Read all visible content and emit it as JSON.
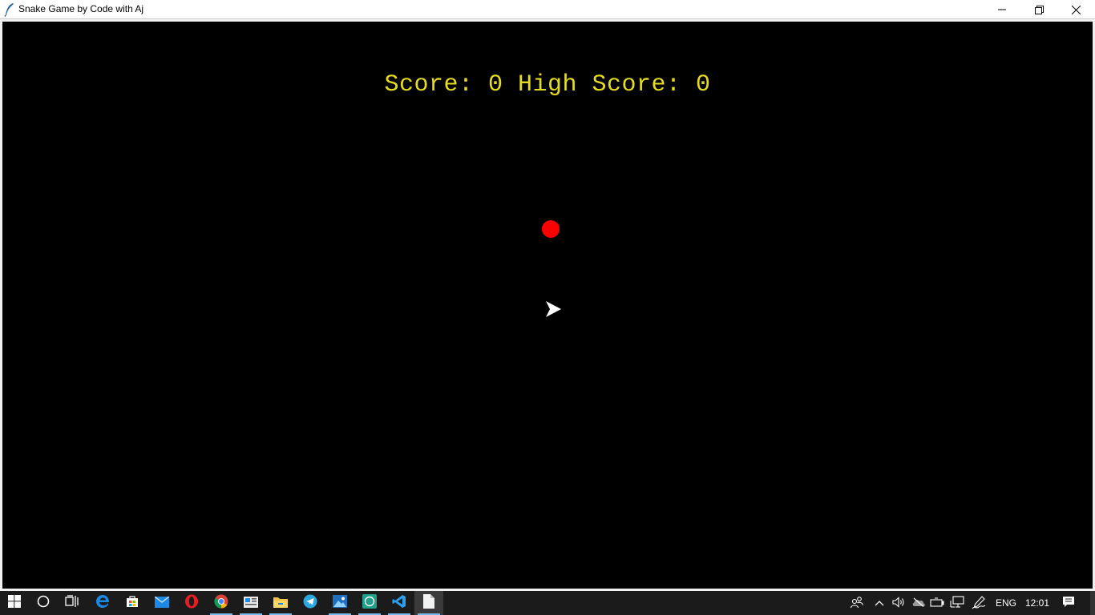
{
  "window": {
    "title": "Snake Game by Code with Aj",
    "icon": "feather-icon",
    "controls": [
      "minimize-icon",
      "restore-icon",
      "close-icon"
    ]
  },
  "game": {
    "score_text": "Score: 0 High Score: 0",
    "score": 0,
    "high_score": 0,
    "background_color": "#000000",
    "text_color": "#e6dc1e",
    "food_color": "#ff0000",
    "snake_color": "#ffffff"
  },
  "taskbar": {
    "apps": [
      {
        "icon": "windows-start-icon"
      },
      {
        "icon": "cortana-search-icon"
      },
      {
        "icon": "task-view-icon"
      },
      {
        "icon": "edge-browser-icon"
      },
      {
        "icon": "store-icon"
      },
      {
        "icon": "mail-icon"
      },
      {
        "icon": "opera-browser-icon"
      },
      {
        "icon": "chrome-browser-icon",
        "running": true
      },
      {
        "icon": "news-icon",
        "running": true
      },
      {
        "icon": "file-explorer-icon",
        "running": true
      },
      {
        "icon": "telegram-icon"
      },
      {
        "icon": "photos-icon",
        "running": true
      },
      {
        "icon": "whatsapp-icon",
        "running": true
      },
      {
        "icon": "vscode-icon",
        "running": true
      },
      {
        "icon": "document-icon",
        "running": true,
        "active": true
      }
    ],
    "tray": {
      "language": "ENG",
      "time": "12:01"
    }
  }
}
